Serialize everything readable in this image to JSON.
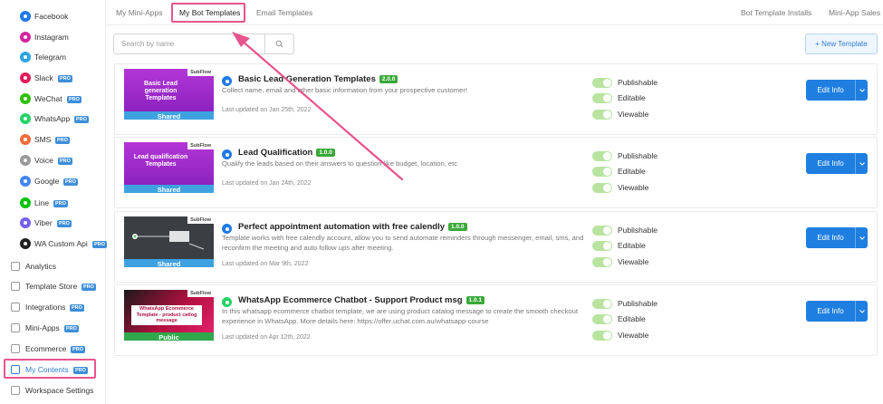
{
  "sidebar": {
    "items": [
      {
        "label": "Facebook",
        "icon": "messenger-icon",
        "color": "#1f7ae6",
        "pro": false
      },
      {
        "label": "Instagram",
        "icon": "instagram-icon",
        "color": "#d6249f",
        "pro": false
      },
      {
        "label": "Telegram",
        "icon": "telegram-icon",
        "color": "#2ca5e0",
        "pro": false
      },
      {
        "label": "Slack",
        "icon": "slack-icon",
        "color": "#e01e5a",
        "pro": true
      },
      {
        "label": "WeChat",
        "icon": "wechat-icon",
        "color": "#2dc100",
        "pro": true
      },
      {
        "label": "WhatsApp",
        "icon": "whatsapp-icon",
        "color": "#25d366",
        "pro": true
      },
      {
        "label": "SMS",
        "icon": "sms-icon",
        "color": "#f26b3a",
        "pro": true
      },
      {
        "label": "Voice",
        "icon": "voice-icon",
        "color": "#999999",
        "pro": true
      },
      {
        "label": "Google",
        "icon": "google-icon",
        "color": "#4285f4",
        "pro": true
      },
      {
        "label": "Line",
        "icon": "line-icon",
        "color": "#00c300",
        "pro": true
      },
      {
        "label": "Viber",
        "icon": "viber-icon",
        "color": "#7360f2",
        "pro": true
      },
      {
        "label": "WA Custom Api",
        "icon": "whatsapp-custom-icon",
        "color": "#222222",
        "pro": true
      }
    ],
    "sections": [
      {
        "label": "Analytics",
        "icon": "analytics-icon",
        "pro": false
      },
      {
        "label": "Template Store",
        "icon": "template-store-icon",
        "pro": true
      },
      {
        "label": "Integrations",
        "icon": "integrations-icon",
        "pro": true
      },
      {
        "label": "Mini-Apps",
        "icon": "mini-apps-icon",
        "pro": true
      },
      {
        "label": "Ecommerce",
        "icon": "ecommerce-icon",
        "pro": true
      },
      {
        "label": "My Contents",
        "icon": "my-contents-icon",
        "pro": true,
        "active": true
      },
      {
        "label": "Workspace Settings",
        "icon": "workspace-settings-icon",
        "pro": false
      }
    ],
    "pro_label": "PRO"
  },
  "tabs": {
    "left": [
      "My Mini-Apps",
      "My Bot Templates",
      "Email Templates"
    ],
    "right": [
      "Bot Template Installs",
      "Mini-App Sales"
    ],
    "active": "My Bot Templates"
  },
  "search": {
    "placeholder": "Search by name",
    "value": ""
  },
  "new_template_label": "+ New Template",
  "toggles": [
    "Publishable",
    "Editable",
    "Viewable"
  ],
  "edit_label": "Edit Info",
  "subflow_label": "SubFlow",
  "templates": [
    {
      "title": "Basic Lead Generation Templates",
      "version": "2.0.0",
      "description": "Collect name, email and other basic information from your prospective customer!",
      "updated": "Last updated on Jan 25th, 2022",
      "thumb_title": "Basic Lead generation Templates",
      "thumb_status": "Shared",
      "channel_icon": "messenger-icon",
      "thumb_color": "#9b29c9",
      "band_color": "#3fa2e0"
    },
    {
      "title": "Lead Qualification",
      "version": "1.0.0",
      "description": "Qualify the leads based on their answers to question like budget, location, etc",
      "updated": "Last updated on Jan 24th, 2022",
      "thumb_title": "Lead qualification Templates",
      "thumb_status": "Shared",
      "channel_icon": "messenger-icon",
      "thumb_color": "#9b29c9",
      "band_color": "#3fa2e0"
    },
    {
      "title": "Perfect appointment automation with free calendly",
      "version": "1.0.0",
      "description": "Template works with free calendly account, allow you to send automate reminders through messenger, email, sms, and reconfirm the meeting and auto follow ups after meeting.",
      "updated": "Last updated on Mar 9th, 2022",
      "thumb_title": "",
      "thumb_status": "Shared",
      "channel_icon": "messenger-icon",
      "thumb_color": "#3b3f44",
      "band_color": "#3fa2e0"
    },
    {
      "title": "WhatsApp Ecommerce Chatbot - Support Product msg",
      "version": "1.0.1",
      "description": "In this whatsapp ecommerce chatbot template, we are using product catalog message to create the smooth checkout experience in WhatsApp. More details here: https://offer.uchat.com.au/whatsapp-course",
      "updated": "Last updated on Apr 12th, 2022",
      "thumb_title": "WhatsApp Ecommerce Template - product catlog message",
      "thumb_status": "Public",
      "channel_icon": "whatsapp-icon",
      "thumb_color": "#b0103f",
      "band_color": "#2ea84a"
    }
  ],
  "colors": {
    "accent": "#1f7fe0",
    "annotation": "#e8558e",
    "toggle_on": "#b8e4a0",
    "version_badge": "#3aa93a"
  }
}
